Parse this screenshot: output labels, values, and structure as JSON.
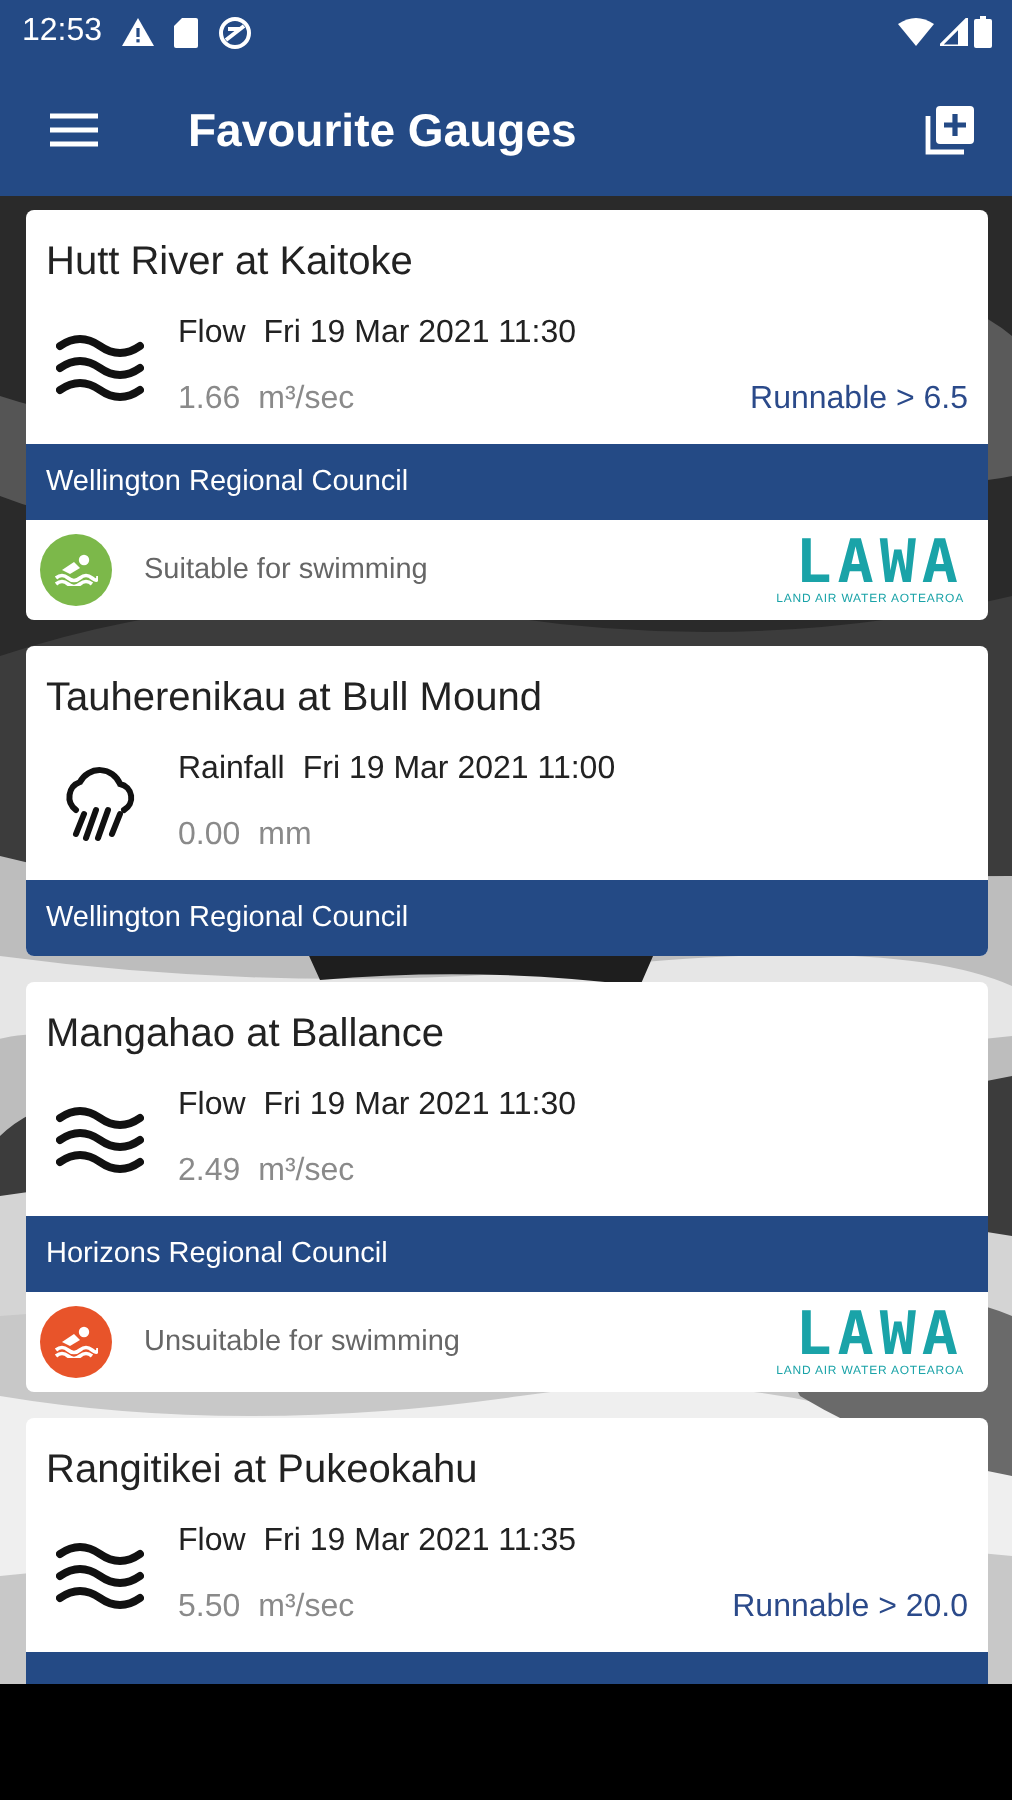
{
  "status_bar": {
    "time": "12:53"
  },
  "app_bar": {
    "title": "Favourite Gauges"
  },
  "gauges": [
    {
      "name": "Hutt River at Kaitoke",
      "kind": "flow",
      "measure": "Flow",
      "timestamp": "Fri 19 Mar 2021 11:30",
      "value": "1.66",
      "unit": "m³/sec",
      "runnable": "Runnable > 6.5",
      "council": "Wellington Regional Council",
      "swimming": {
        "label": "Suitable for swimming",
        "color": "#7cb84a",
        "logo": "LAWA",
        "logo_caption": "LAND AIR WATER AOTEAROA"
      }
    },
    {
      "name": "Tauherenikau at Bull Mound",
      "kind": "rainfall",
      "measure": "Rainfall",
      "timestamp": "Fri 19 Mar 2021 11:00",
      "value": "0.00",
      "unit": "mm",
      "council": "Wellington Regional Council"
    },
    {
      "name": "Mangahao at Ballance",
      "kind": "flow",
      "measure": "Flow",
      "timestamp": "Fri 19 Mar 2021 11:30",
      "value": "2.49",
      "unit": "m³/sec",
      "council": "Horizons Regional Council",
      "swimming": {
        "label": "Unsuitable for swimming",
        "color": "#e8542a",
        "logo": "LAWA",
        "logo_caption": "LAND AIR WATER AOTEAROA"
      }
    },
    {
      "name": "Rangitikei at Pukeokahu",
      "kind": "flow",
      "measure": "Flow",
      "timestamp": "Fri 19 Mar 2021 11:35",
      "value": "5.50",
      "unit": "m³/sec",
      "runnable": "Runnable > 20.0"
    }
  ]
}
